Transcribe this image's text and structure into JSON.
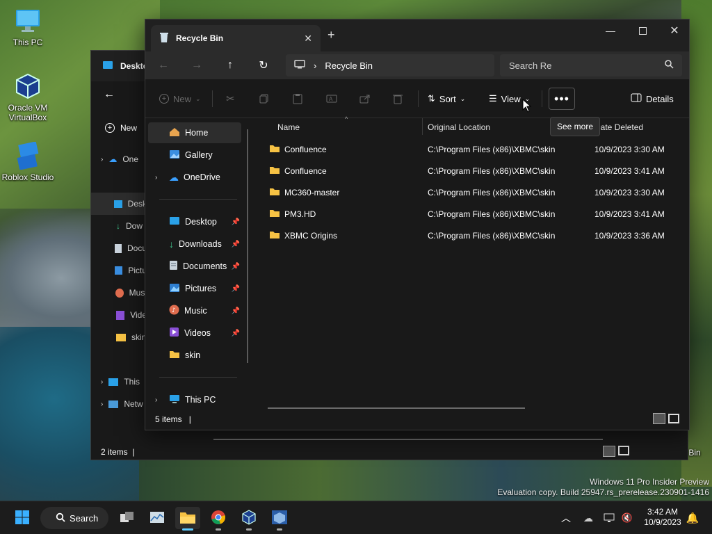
{
  "desktop": {
    "icons": [
      {
        "label": "This PC"
      },
      {
        "label": "Oracle VM VirtualBox"
      },
      {
        "label": "Roblox Studio"
      },
      {
        "label": "Recycle Bin"
      }
    ],
    "watermark_line1": "Windows 11 Pro Insider Preview",
    "watermark_line2": "Evaluation copy. Build 25947.rs_prerelease.230901-1416"
  },
  "back_window": {
    "title": "Deskto",
    "new_label": "New",
    "sidebar": [
      "One",
      "Desk",
      "Dow",
      "Docu",
      "Pictu",
      "Musi",
      "Vide",
      "skin",
      "This",
      "Netw"
    ],
    "status": "2 items"
  },
  "window": {
    "tab_title": "Recycle Bin",
    "breadcrumb": "Recycle Bin",
    "search_placeholder": "Search Re",
    "tooltip": "See more",
    "toolbar": {
      "new_label": "New",
      "sort_label": "Sort",
      "view_label": "View",
      "details_label": "Details"
    },
    "nav": {
      "home": "Home",
      "gallery": "Gallery",
      "onedrive": "OneDrive",
      "pinned": [
        {
          "label": "Desktop"
        },
        {
          "label": "Downloads"
        },
        {
          "label": "Documents"
        },
        {
          "label": "Pictures"
        },
        {
          "label": "Music"
        },
        {
          "label": "Videos"
        },
        {
          "label": "skin"
        }
      ],
      "thispc": "This PC"
    },
    "columns": {
      "name": "Name",
      "location": "Original Location",
      "date": "Date Deleted"
    },
    "rows": [
      {
        "name": "Confluence",
        "location": "C:\\Program Files (x86)\\XBMC\\skin",
        "date": "10/9/2023 3:30 AM"
      },
      {
        "name": "Confluence",
        "location": "C:\\Program Files (x86)\\XBMC\\skin",
        "date": "10/9/2023 3:41 AM"
      },
      {
        "name": "MC360-master",
        "location": "C:\\Program Files (x86)\\XBMC\\skin",
        "date": "10/9/2023 3:30 AM"
      },
      {
        "name": "PM3.HD",
        "location": "C:\\Program Files (x86)\\XBMC\\skin",
        "date": "10/9/2023 3:41 AM"
      },
      {
        "name": "XBMC Origins",
        "location": "C:\\Program Files (x86)\\XBMC\\skin",
        "date": "10/9/2023 3:36 AM"
      }
    ],
    "status": "5 items"
  },
  "taskbar": {
    "search_label": "Search",
    "time": "3:42 AM",
    "date": "10/9/2023"
  },
  "colors": {
    "accent": "#60cdff",
    "folder": "#f6c244",
    "window_bg": "#191919"
  }
}
